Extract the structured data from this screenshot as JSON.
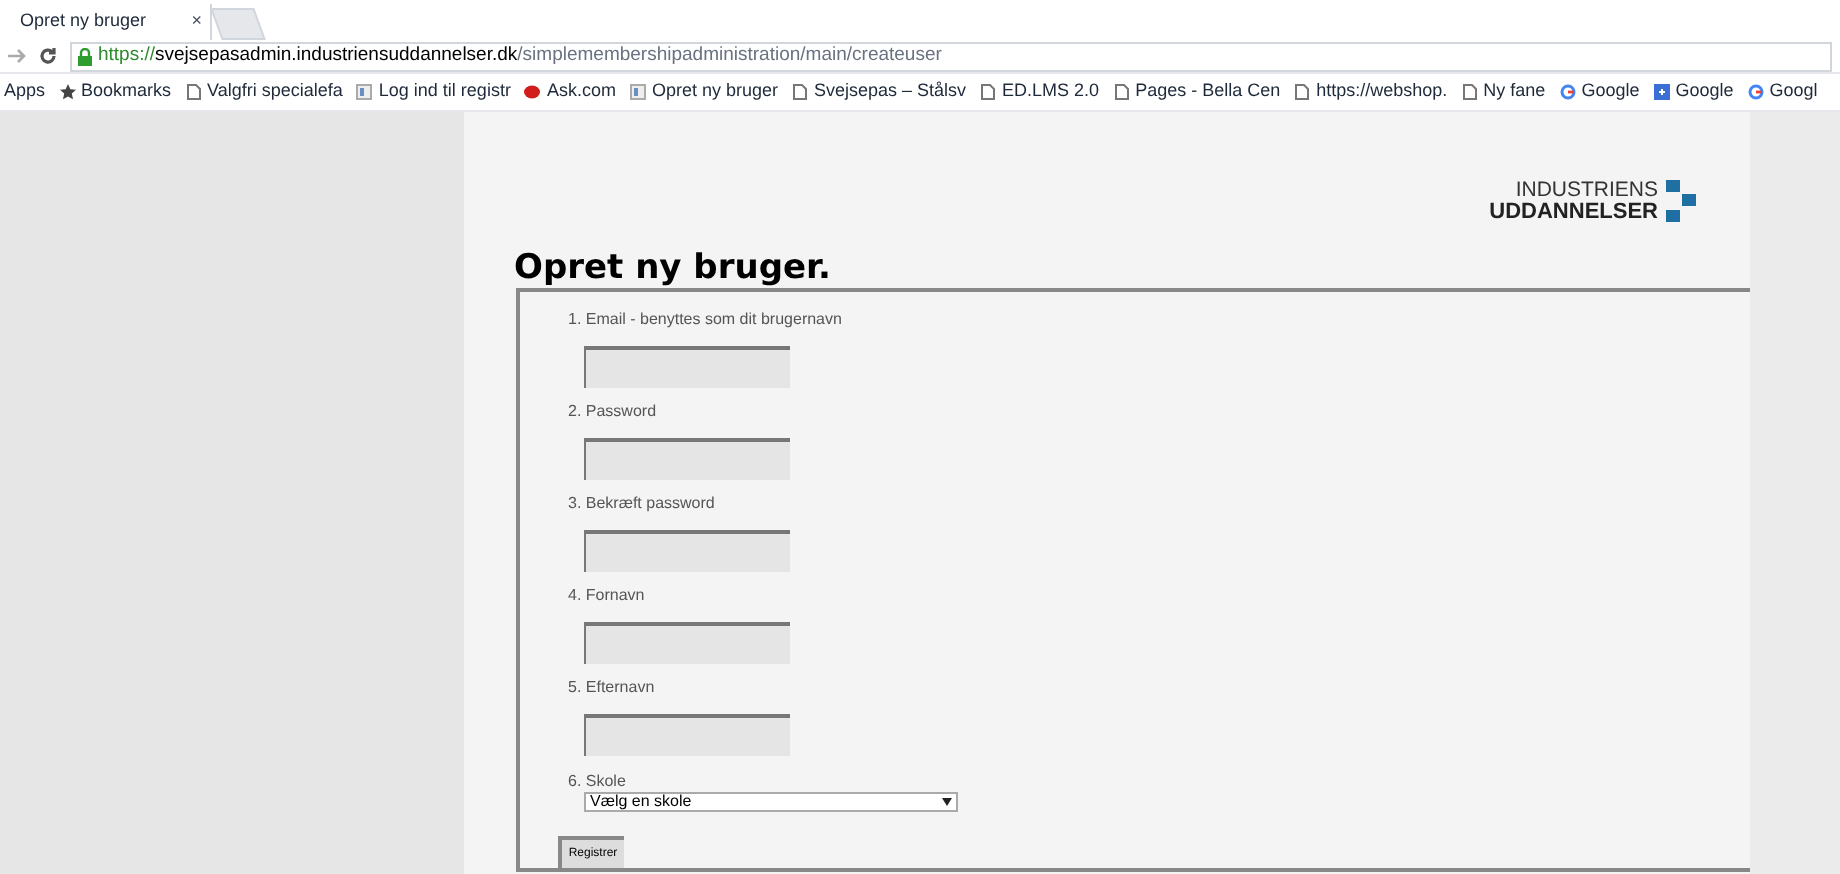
{
  "tab": {
    "title": "Opret ny bruger",
    "close": "×"
  },
  "address": {
    "scheme": "https://",
    "host": "svejsepasadmin.industriensuddannelser.dk",
    "path": "/simplemembershipadministration/main/createuser"
  },
  "bookmarks": [
    {
      "kind": "apps",
      "label": "Apps"
    },
    {
      "kind": "star",
      "label": "Bookmarks"
    },
    {
      "kind": "page",
      "label": "Valgfri specialefa"
    },
    {
      "kind": "site",
      "label": "Log ind til registr"
    },
    {
      "kind": "ask",
      "label": "Ask.com"
    },
    {
      "kind": "site",
      "label": "Opret ny bruger"
    },
    {
      "kind": "page",
      "label": "Svejsepas – Stålsv"
    },
    {
      "kind": "page",
      "label": "ED.LMS 2.0"
    },
    {
      "kind": "page",
      "label": "Pages - Bella Cen"
    },
    {
      "kind": "page",
      "label": "https://webshop."
    },
    {
      "kind": "page",
      "label": "Ny fane"
    },
    {
      "kind": "google",
      "label": "Google"
    },
    {
      "kind": "gplus",
      "label": "Google"
    },
    {
      "kind": "google",
      "label": "Googl"
    }
  ],
  "logo": {
    "line_1": "INDUSTRIENS",
    "line_2": "UDDANNELSER"
  },
  "heading": "Opret ny bruger.",
  "fields": [
    {
      "label": "1. Email - benyttes som dit brugernavn"
    },
    {
      "label": "2. Password"
    },
    {
      "label": "3. Bekræft password"
    },
    {
      "label": "4. Fornavn"
    },
    {
      "label": "5. Efternavn"
    }
  ],
  "school": {
    "label": "6. Skole",
    "value": "Vælg en skole"
  },
  "submit": "Registrer"
}
